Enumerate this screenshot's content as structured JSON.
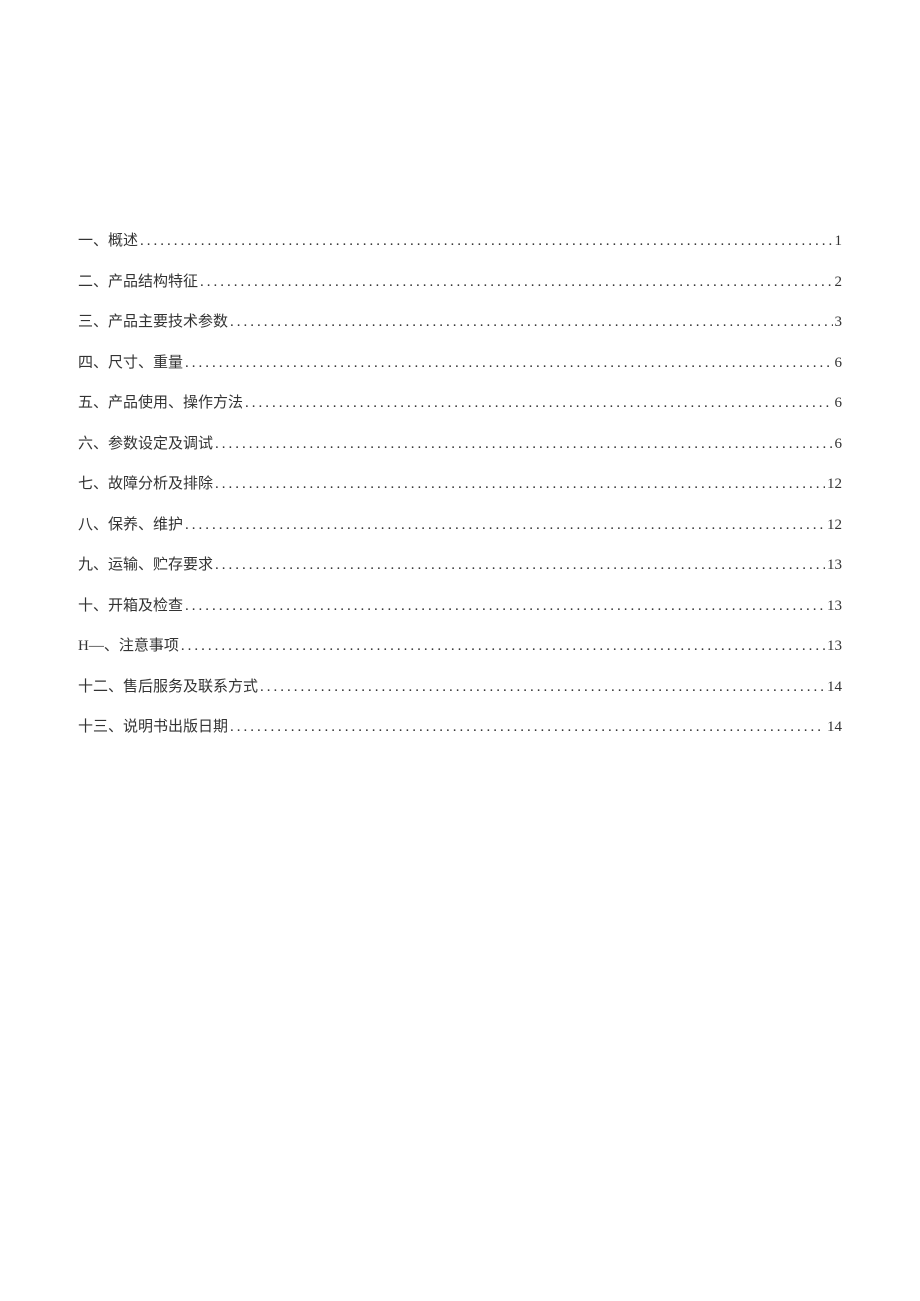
{
  "toc": {
    "entries": [
      {
        "title": "一、概述",
        "page": "1"
      },
      {
        "title": "二、产品结构特征",
        "page": "2"
      },
      {
        "title": "三、产品主要技术参数",
        "page": "3"
      },
      {
        "title": "四、尺寸、重量",
        "page": "6"
      },
      {
        "title": "五、产品使用、操作方法",
        "page": "6"
      },
      {
        "title": "六、参数设定及调试",
        "page": "6"
      },
      {
        "title": "七、故障分析及排除",
        "page": "12"
      },
      {
        "title": "八、保养、维护",
        "page": "12"
      },
      {
        "title": "九、运输、贮存要求",
        "page": "13"
      },
      {
        "title": "十、开箱及检查",
        "page": "13"
      },
      {
        "title": "H—、注意事项",
        "page": "13"
      },
      {
        "title": "十二、售后服务及联系方式",
        "page": "14"
      },
      {
        "title": "十三、说明书出版日期",
        "page": "14"
      }
    ]
  }
}
